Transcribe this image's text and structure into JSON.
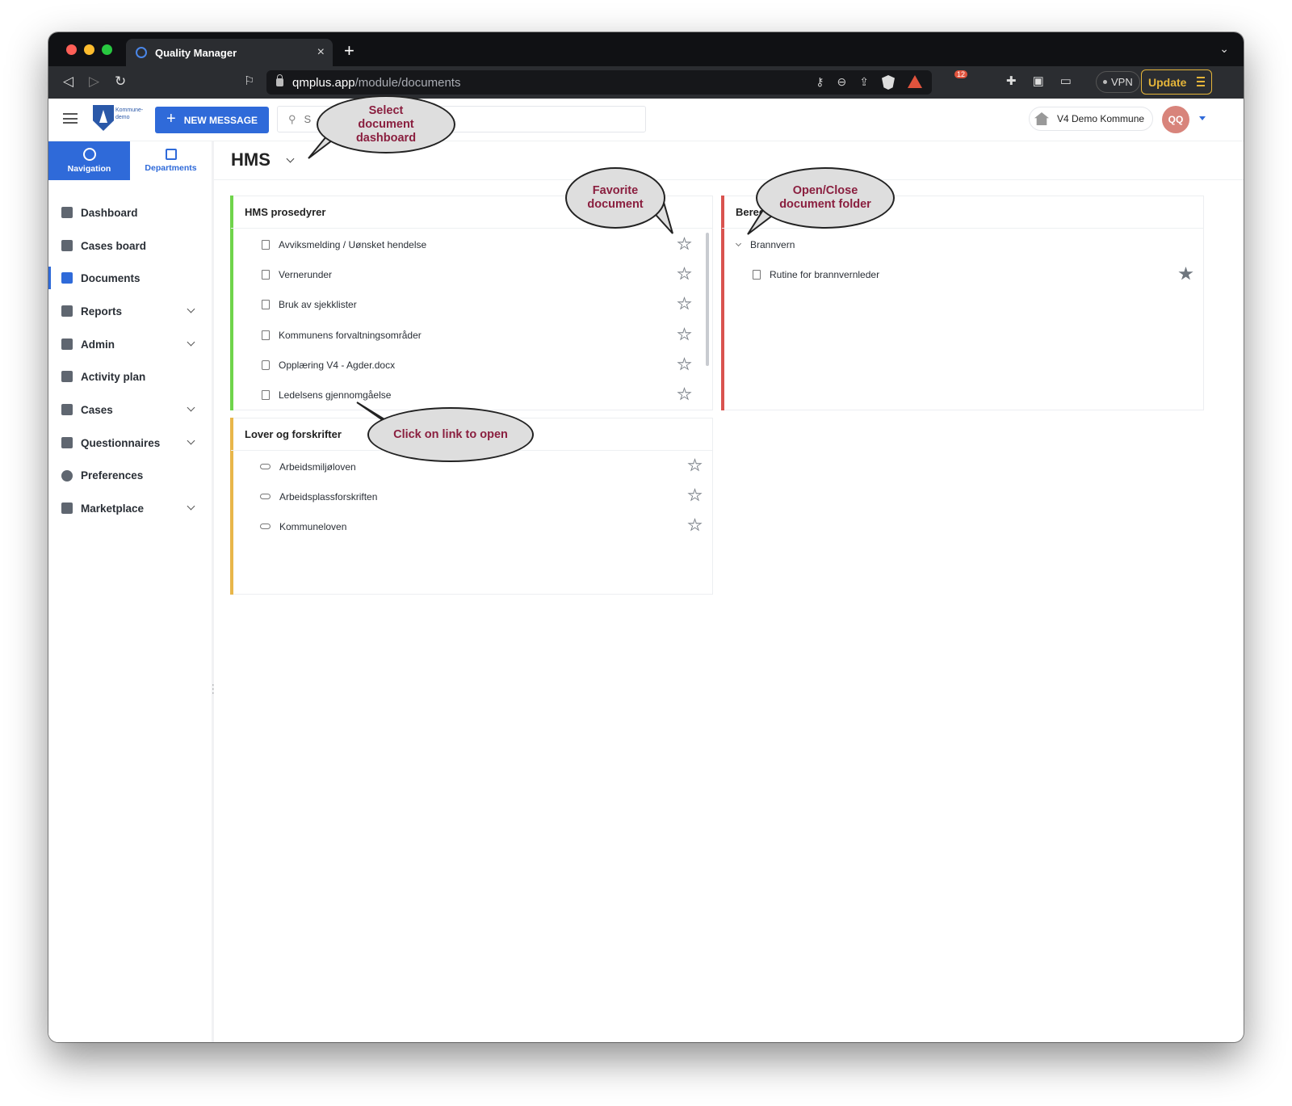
{
  "browser": {
    "tab_title": "Quality Manager",
    "tab_close": "×",
    "new_tab": "+",
    "url_host": "qmplus.app",
    "url_path": "/module/documents",
    "notification_count": "12",
    "vpn_label": "VPN",
    "update_label": "Update",
    "traffic_lights": [
      "#ff5f57",
      "#febc2e",
      "#28c840"
    ]
  },
  "header": {
    "logo_text": "Kommune-\ndemo",
    "new_message_label": "NEW MESSAGE",
    "search_placeholder": "S",
    "org_name": "V4 Demo Kommune",
    "avatar_initials": "QQ"
  },
  "sidebar": {
    "tabs": [
      {
        "label": "Navigation",
        "icon": "compass-icon",
        "active": true
      },
      {
        "label": "Departments",
        "icon": "org-chart-icon",
        "active": false
      }
    ],
    "items": [
      {
        "label": "Dashboard",
        "icon": "dashboard-icon",
        "expandable": false,
        "active": false
      },
      {
        "label": "Cases board",
        "icon": "board-icon",
        "expandable": false,
        "active": false
      },
      {
        "label": "Documents",
        "icon": "folder-icon",
        "expandable": false,
        "active": true
      },
      {
        "label": "Reports",
        "icon": "bar-chart-icon",
        "expandable": true,
        "active": false
      },
      {
        "label": "Admin",
        "icon": "gears-icon",
        "expandable": true,
        "active": false
      },
      {
        "label": "Activity plan",
        "icon": "calendar-icon",
        "expandable": false,
        "active": false
      },
      {
        "label": "Cases",
        "icon": "cases-icon",
        "expandable": true,
        "active": false
      },
      {
        "label": "Questionnaires",
        "icon": "clipboard-icon",
        "expandable": true,
        "active": false
      },
      {
        "label": "Preferences",
        "icon": "gear-icon",
        "expandable": false,
        "active": false
      },
      {
        "label": "Marketplace",
        "icon": "store-icon",
        "expandable": true,
        "active": false
      }
    ]
  },
  "page": {
    "title": "HMS"
  },
  "cards": {
    "hms": {
      "title": "HMS prosedyrer",
      "color": "#6fd44b",
      "docs": [
        {
          "label": "Avviksmelding / Uønsket hendelse",
          "type": "document"
        },
        {
          "label": "Vernerunder",
          "type": "document"
        },
        {
          "label": "Bruk av sjekklister",
          "type": "document"
        },
        {
          "label": "Kommunens forvaltningsområder",
          "type": "document"
        },
        {
          "label": "Opplæring V4 - Agder.docx",
          "type": "word"
        },
        {
          "label": "Ledelsens gjennomgåelse",
          "type": "document"
        }
      ]
    },
    "lover": {
      "title": "Lover og forskrifter",
      "color": "#e8b64a",
      "docs": [
        {
          "label": "Arbeidsmiljøloven",
          "type": "link"
        },
        {
          "label": "Arbeidsplassforskriften",
          "type": "link"
        },
        {
          "label": "Kommuneloven",
          "type": "link"
        }
      ]
    },
    "beredskap": {
      "title": "Bered",
      "color": "#d9534f",
      "folder": "Brannvern",
      "docs": [
        {
          "label": "Rutine for brannvernleder",
          "type": "document",
          "favorite": true
        }
      ]
    }
  },
  "callouts": {
    "select_dashboard": "Select document dashboard",
    "favorite": "Favorite document",
    "open_close": "Open/Close document folder",
    "click_link": "Click on link to open"
  }
}
